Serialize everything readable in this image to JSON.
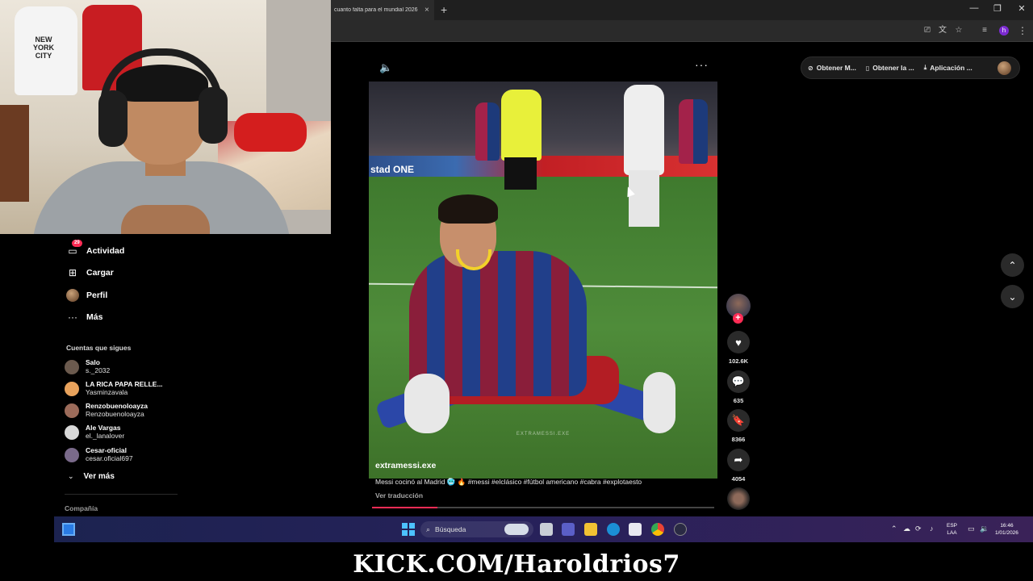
{
  "browser": {
    "tab_title": "cuanto falta para el mundial 2026",
    "tab_close": "×",
    "new_tab": "+",
    "window_minimize": "—",
    "window_restore": "❐",
    "window_close": "✕",
    "profile_initial": "h"
  },
  "webcam": {
    "hoodie_text": "NEW YORK CITY"
  },
  "sidebar": {
    "items": [
      {
        "label": "Actividad",
        "badge": "29",
        "icon": "inbox-icon"
      },
      {
        "label": "Cargar",
        "icon": "upload-icon"
      },
      {
        "label": "Perfil",
        "icon": "profile-avatar"
      },
      {
        "label": "Más",
        "icon": "more-horizontal-icon"
      }
    ],
    "following_title": "Cuentas que sigues",
    "following": [
      {
        "name": "Salo",
        "handle": "s._2032",
        "color": "#6b5a4e"
      },
      {
        "name": "LA RICA PAPA RELLE...",
        "handle": "Yasminzavala",
        "color": "#e8a25c"
      },
      {
        "name": "Renzobuenoloayza",
        "handle": "Renzobuenoloayza",
        "color": "#9c6b5a"
      },
      {
        "name": "Ale Vargas",
        "handle": "el._lanalover",
        "color": "#d8d8d8"
      },
      {
        "name": "Cesar-oficial",
        "handle": "cesar.oficial697",
        "color": "#7a6a8a"
      }
    ],
    "see_more": "Ver más",
    "company": "Compañía"
  },
  "video": {
    "watermark": "EXTRAMESSI.EXE",
    "ads_text": "stad  ONE",
    "author": "extramessi.exe",
    "caption": "Messi cocinó al Madrid 🥶 🔥 #messi #elclásico #fútbol americano #cabra #explotaesto",
    "see_translation": "Ver traducción",
    "progress_percent": 19
  },
  "actions": {
    "likes": "102.6K",
    "comments": "635",
    "saves": "8366",
    "shares": "4054"
  },
  "top_actions": {
    "pills": [
      {
        "label": "Obtener M...",
        "icon": "coin-icon"
      },
      {
        "label": "Obtener la ...",
        "icon": "phone-icon"
      },
      {
        "label": "Aplicación ...",
        "icon": "download-icon"
      }
    ]
  },
  "taskbar": {
    "search_label": "Búsqueda",
    "lang_top": "ESP",
    "lang_bottom": "LAA",
    "time": "16:46",
    "date": "1/01/2026"
  },
  "banner": {
    "text": "KICK.COM/Haroldrios7"
  },
  "colors": {
    "accent": "#fe2c55",
    "taskbar_blue": "#4cc2ff"
  }
}
